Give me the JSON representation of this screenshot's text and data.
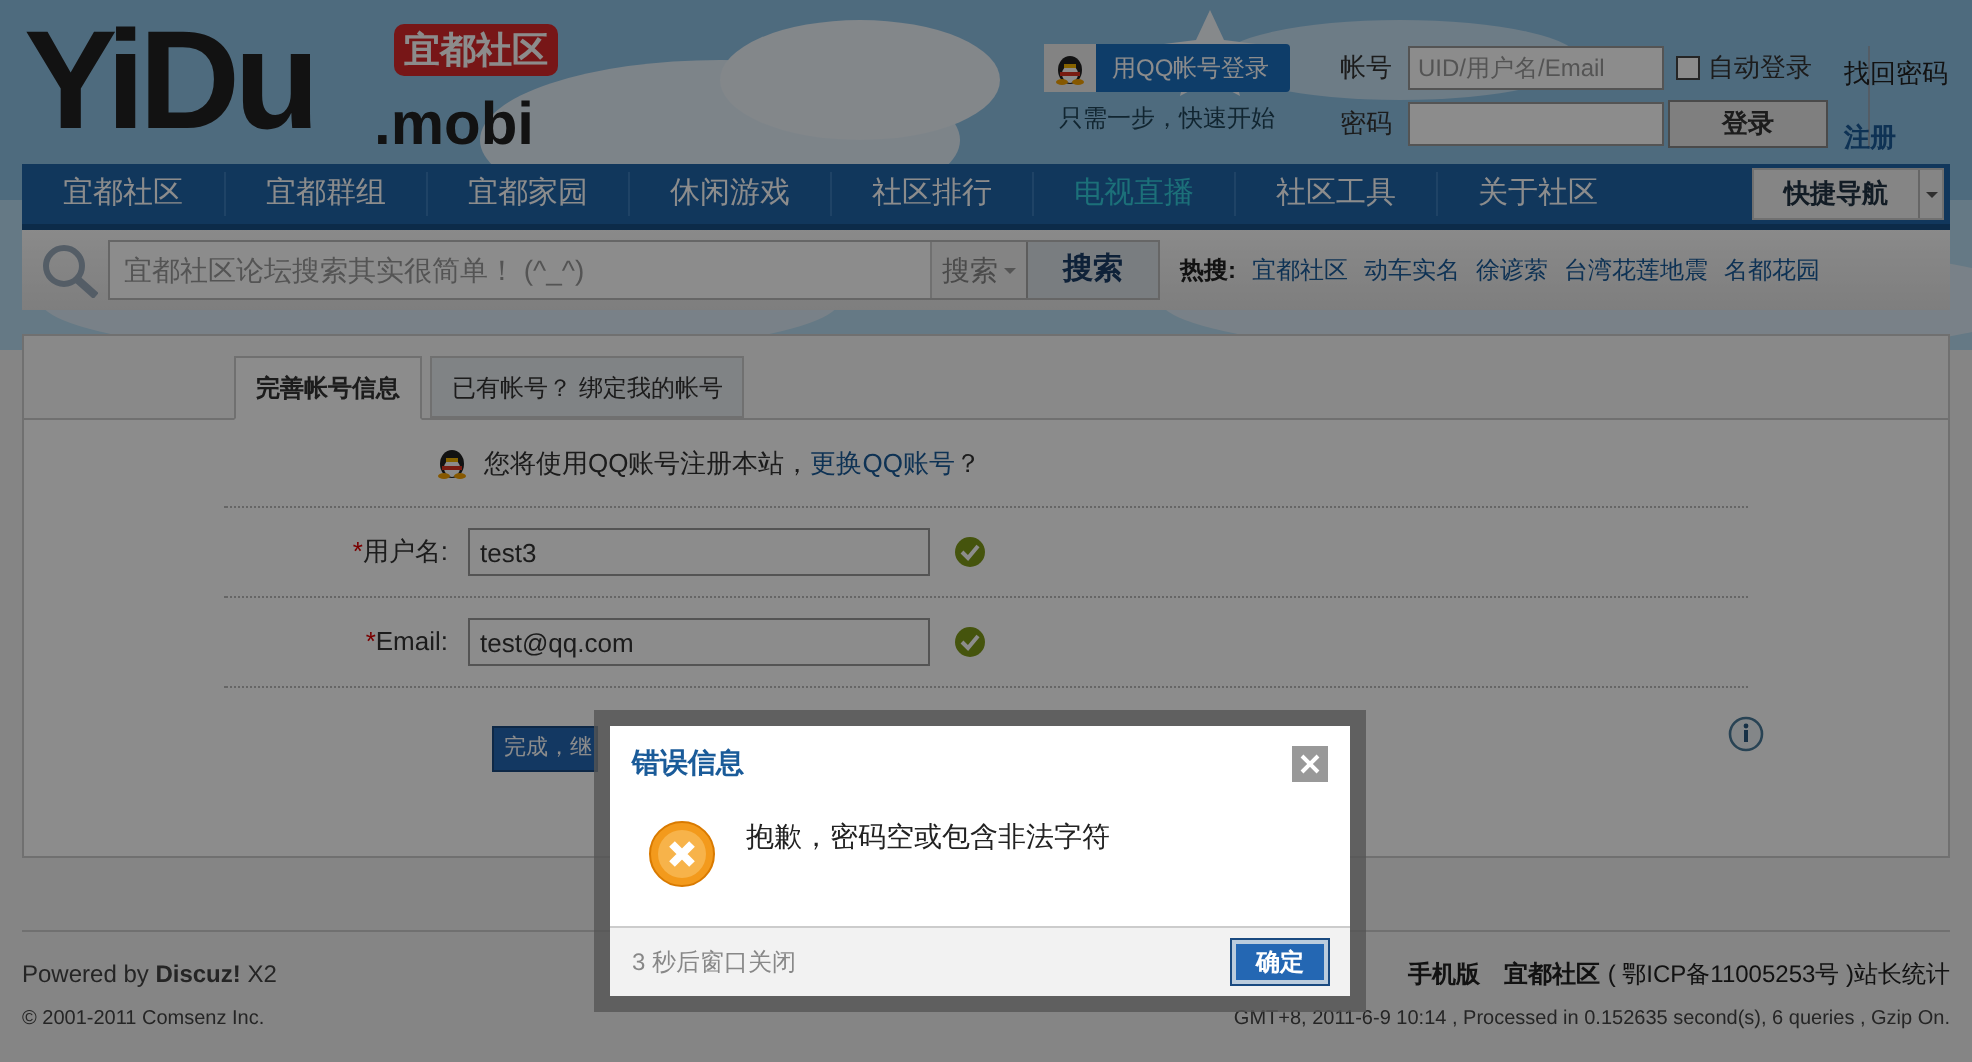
{
  "logo": {
    "name": "YiDu",
    "badge": "宜都社区",
    "suffix": ".mobi"
  },
  "qq_login": {
    "button": "用QQ帐号登录",
    "hint": "只需一步，快速开始"
  },
  "login_form": {
    "account_label": "帐号",
    "account_placeholder": "UID/用户名/Email",
    "auto_login": {
      "label": "自动登录",
      "checked": false
    },
    "password_label": "密码",
    "login_button": "登录",
    "links": [
      "找回密码",
      "注册"
    ]
  },
  "nav": {
    "items": [
      {
        "label": "宜都社区",
        "selected": false
      },
      {
        "label": "宜都群组",
        "selected": false
      },
      {
        "label": "宜都家园",
        "selected": false
      },
      {
        "label": "休闲游戏",
        "selected": false
      },
      {
        "label": "社区排行",
        "selected": false
      },
      {
        "label": "电视直播",
        "selected": true
      },
      {
        "label": "社区工具",
        "selected": false
      },
      {
        "label": "关于社区",
        "selected": false
      }
    ],
    "quick_nav": "快捷导航"
  },
  "search": {
    "placeholder": "宜都社区论坛搜索其实很简单！ (^_^)",
    "type": "搜索",
    "button": "搜索",
    "hot_label": "热搜:",
    "hot": [
      "宜都社区",
      "动车实名",
      "徐谚萦",
      "台湾花莲地震",
      "名都花园"
    ]
  },
  "tabs": [
    {
      "label": "完善帐号信息",
      "selected": true
    },
    {
      "label": "已有帐号？ 绑定我的帐号",
      "selected": false
    }
  ],
  "notice": {
    "text": "您将使用QQ账号注册本站，",
    "link": "更换QQ账号",
    "end": "？"
  },
  "fields": [
    {
      "required_mark": "*",
      "label": "用户名:",
      "value": "test3",
      "valid": true
    },
    {
      "required_mark": "*",
      "label": "Email:",
      "value": "test@qq.com",
      "valid": true
    }
  ],
  "submit": "完成，继",
  "footer": {
    "powered": "Powered by",
    "brand": "Discuz!",
    "version": "X2",
    "copyright": "© 2001-2011 Comsenz Inc.",
    "links": [
      "手机版",
      "宜都社区"
    ],
    "icp": "( 鄂ICP备11005253号 )",
    "stats_link": "站长统计",
    "stats": "GMT+8, 2011-6-9 10:14 , Processed in 0.152635 second(s), 6 queries , Gzip On."
  },
  "dialog": {
    "title": "错误信息",
    "message": "抱歉，密码空或包含非法字符",
    "countdown": "3 秒后窗口关闭",
    "button": "确定"
  }
}
